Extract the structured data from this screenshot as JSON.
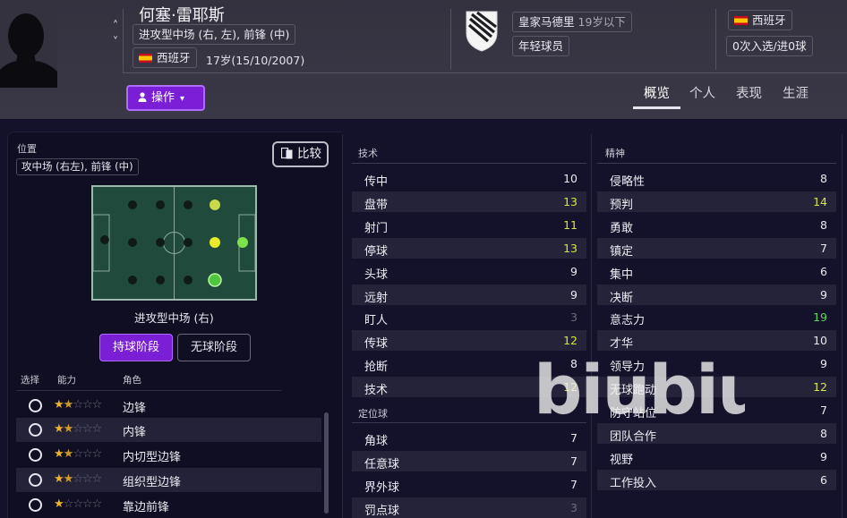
{
  "header": {
    "name": "何塞·雷耶斯",
    "positions": "进攻型中场 (右, 左), 前锋 (中)",
    "nationality": "西班牙",
    "age": "17岁(15/10/2007)",
    "club": "皇家马德里",
    "club_squad": "19岁以下",
    "club_status": "年轻球员",
    "national_team": "西班牙",
    "caps": "0次入选/进0球"
  },
  "action_button": "操作",
  "tabs": [
    "概览",
    "个人",
    "表现",
    "生涯"
  ],
  "position_panel": {
    "title": "位置",
    "current": "攻中场 (右左), 前锋 (中)",
    "compare_label": "比较",
    "selected_position": "进攻型中场 (右)",
    "phases": [
      "持球阶段",
      "无球阶段"
    ],
    "columns": [
      "选择",
      "能力",
      "角色"
    ],
    "roles": [
      {
        "name": "边锋",
        "stars": 1.5
      },
      {
        "name": "内锋",
        "stars": 1.5
      },
      {
        "name": "内切型边锋",
        "stars": 1.5
      },
      {
        "name": "组织型边锋",
        "stars": 1.5
      },
      {
        "name": "靠边前锋",
        "stars": 1
      }
    ]
  },
  "technical": {
    "title": "技术",
    "rows": [
      {
        "name": "传中",
        "value": "10",
        "tone": "normal"
      },
      {
        "name": "盘带",
        "value": "13",
        "tone": "yellow"
      },
      {
        "name": "射门",
        "value": "11",
        "tone": "yellow"
      },
      {
        "name": "停球",
        "value": "13",
        "tone": "yellow"
      },
      {
        "name": "头球",
        "value": "9",
        "tone": "normal"
      },
      {
        "name": "远射",
        "value": "9",
        "tone": "normal"
      },
      {
        "name": "盯人",
        "value": "3",
        "tone": "low"
      },
      {
        "name": "传球",
        "value": "12",
        "tone": "yellow"
      },
      {
        "name": "抢断",
        "value": "8",
        "tone": "normal"
      },
      {
        "name": "技术",
        "value": "12",
        "tone": "yellow"
      }
    ]
  },
  "set_pieces": {
    "title": "定位球",
    "rows": [
      {
        "name": "角球",
        "value": "7",
        "tone": "normal"
      },
      {
        "name": "任意球",
        "value": "7",
        "tone": "normal"
      },
      {
        "name": "界外球",
        "value": "7",
        "tone": "normal"
      },
      {
        "name": "罚点球",
        "value": "3",
        "tone": "low"
      }
    ]
  },
  "mental": {
    "title": "精神",
    "rows": [
      {
        "name": "侵略性",
        "value": "8",
        "tone": "normal"
      },
      {
        "name": "预判",
        "value": "14",
        "tone": "yellow"
      },
      {
        "name": "勇敢",
        "value": "8",
        "tone": "normal"
      },
      {
        "name": "镇定",
        "value": "7",
        "tone": "normal"
      },
      {
        "name": "集中",
        "value": "6",
        "tone": "normal"
      },
      {
        "name": "决断",
        "value": "9",
        "tone": "normal"
      },
      {
        "name": "意志力",
        "value": "19",
        "tone": "green"
      },
      {
        "name": "才华",
        "value": "10",
        "tone": "normal"
      },
      {
        "name": "领导力",
        "value": "9",
        "tone": "normal"
      },
      {
        "name": "无球跑动",
        "value": "12",
        "tone": "yellow"
      },
      {
        "name": "防守站位",
        "value": "7",
        "tone": "normal"
      },
      {
        "name": "团队合作",
        "value": "8",
        "tone": "normal"
      },
      {
        "name": "视野",
        "value": "9",
        "tone": "normal"
      },
      {
        "name": "工作投入",
        "value": "6",
        "tone": "normal"
      }
    ]
  },
  "watermark": "biubiu",
  "colors": {
    "accent_purple": "#7a1fd6",
    "attr_yellow": "#d7e63a",
    "attr_green": "#5bd95a",
    "star": "#f1b22b"
  }
}
